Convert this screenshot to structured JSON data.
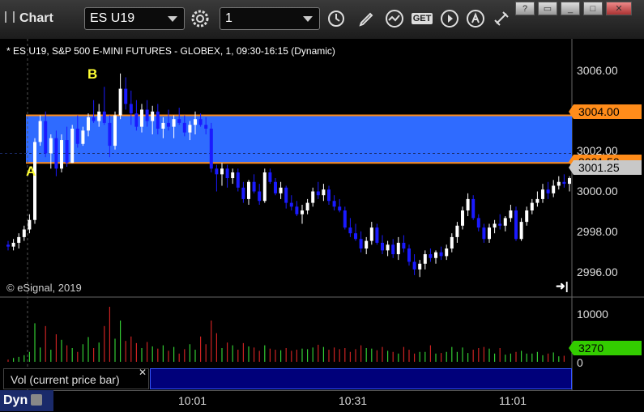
{
  "toolbar": {
    "title": "Chart",
    "symbol": "ES U19",
    "interval": "1",
    "get_label": "GET"
  },
  "chart_header": "* ES U19, S&P 500 E-MINI FUTURES - GLOBEX, 1, 09:30-16:15 (Dynamic)",
  "copyright": "© eSignal, 2019",
  "annotations": {
    "a": "A",
    "b": "B"
  },
  "price_axis": {
    "ticks": [
      "3006.00",
      "3004.00",
      "3002.00",
      "3000.00",
      "2998.00",
      "2996.00"
    ],
    "tags": [
      {
        "label": "3004.00",
        "bg": "#ff8c1a",
        "fg": "#000"
      },
      {
        "label": "3001.50",
        "bg": "#ff8c1a",
        "fg": "#000"
      },
      {
        "label": "3001.25",
        "bg": "#c8c8c8",
        "fg": "#000"
      }
    ]
  },
  "volume_axis": {
    "ticks": [
      "10000",
      "0"
    ],
    "tag": {
      "label": "3270",
      "bg": "#33cc00",
      "fg": "#000"
    }
  },
  "volume_label": "Vol (current price bar)",
  "time_axis": {
    "ticks": [
      "10:01",
      "10:31",
      "11:01"
    ]
  },
  "status": {
    "dyn_label": "Dyn"
  },
  "colors": {
    "up": "#ffffff",
    "down": "#1a1aff",
    "zone": "#2f6bff",
    "zone_line": "#ff8c1a",
    "vol_up": "#33cc33",
    "vol_down": "#cc2222"
  },
  "chart_data": {
    "type": "candlestick",
    "ylim": [
      2995.0,
      3007.0
    ],
    "zone": [
      3001.5,
      3004.0
    ],
    "candles": [
      [
        2997.2,
        2997.4,
        2996.9,
        2997.1
      ],
      [
        2997.1,
        2997.5,
        2996.9,
        2997.3
      ],
      [
        2997.3,
        2997.8,
        2997.0,
        2997.6
      ],
      [
        2997.6,
        2998.2,
        2997.4,
        2998.0
      ],
      [
        2998.0,
        2998.8,
        2997.8,
        2998.5
      ],
      [
        2998.5,
        3002.8,
        2998.3,
        3002.6
      ],
      [
        3002.6,
        3004.0,
        3002.4,
        3003.7
      ],
      [
        3003.7,
        3004.2,
        3001.8,
        3002.0
      ],
      [
        3002.0,
        3003.0,
        3001.2,
        3002.8
      ],
      [
        3002.8,
        3003.2,
        3000.8,
        3001.2
      ],
      [
        3001.2,
        3003.0,
        3001.0,
        3002.7
      ],
      [
        3002.7,
        3003.4,
        3001.3,
        3001.5
      ],
      [
        3001.5,
        3003.5,
        3001.5,
        3003.3
      ],
      [
        3003.3,
        3004.0,
        3002.3,
        3002.5
      ],
      [
        3002.5,
        3003.4,
        3002.4,
        3003.2
      ],
      [
        3003.2,
        3004.1,
        3002.9,
        3003.9
      ],
      [
        3003.9,
        3004.8,
        3003.6,
        3003.7
      ],
      [
        3003.7,
        3004.6,
        3003.4,
        3004.2
      ],
      [
        3004.2,
        3005.5,
        3003.5,
        3003.6
      ],
      [
        3003.6,
        3004.0,
        3001.8,
        3002.4
      ],
      [
        3002.4,
        3004.2,
        3002.2,
        3004.0
      ],
      [
        3004.0,
        3006.2,
        3003.8,
        3005.4
      ],
      [
        3005.4,
        3006.0,
        3004.3,
        3004.6
      ],
      [
        3004.6,
        3005.3,
        3003.5,
        3004.1
      ],
      [
        3004.1,
        3004.8,
        3003.2,
        3003.4
      ],
      [
        3003.4,
        3004.6,
        3003.1,
        3004.3
      ],
      [
        3004.3,
        3004.8,
        3003.4,
        3003.7
      ],
      [
        3003.7,
        3004.5,
        3003.0,
        3004.2
      ],
      [
        3004.2,
        3004.6,
        3003.0,
        3003.3
      ],
      [
        3003.3,
        3003.9,
        3002.8,
        3003.6
      ],
      [
        3003.6,
        3004.3,
        3003.2,
        3003.4
      ],
      [
        3003.4,
        3004.0,
        3002.8,
        3003.8
      ],
      [
        3003.8,
        3004.4,
        3003.5,
        3003.6
      ],
      [
        3003.6,
        3004.0,
        3002.9,
        3003.1
      ],
      [
        3003.1,
        3003.7,
        3002.7,
        3003.5
      ],
      [
        3003.5,
        3004.2,
        3003.0,
        3003.8
      ],
      [
        3003.8,
        3004.1,
        3003.4,
        3003.5
      ],
      [
        3003.5,
        3003.9,
        3003.0,
        3003.3
      ],
      [
        3003.3,
        3003.6,
        3001.0,
        3001.2
      ],
      [
        3001.2,
        3001.4,
        3000.0,
        3000.9
      ],
      [
        3000.9,
        3001.5,
        3000.3,
        3001.2
      ],
      [
        3001.2,
        3001.4,
        3000.2,
        3000.7
      ],
      [
        3000.7,
        3001.2,
        3000.4,
        3001.0
      ],
      [
        3001.0,
        3001.2,
        3000.0,
        3000.2
      ],
      [
        3000.2,
        3000.5,
        2999.4,
        2999.6
      ],
      [
        2999.6,
        3000.6,
        2999.3,
        3000.5
      ],
      [
        3000.5,
        3000.9,
        2999.9,
        3000.0
      ],
      [
        3000.0,
        3000.4,
        2999.3,
        2999.5
      ],
      [
        2999.5,
        3001.2,
        2999.4,
        3001.0
      ],
      [
        3001.0,
        3001.2,
        3000.4,
        3000.5
      ],
      [
        3000.5,
        3000.7,
        2999.8,
        2999.9
      ],
      [
        2999.9,
        3000.5,
        2999.6,
        3000.2
      ],
      [
        3000.2,
        3000.3,
        2999.1,
        2999.4
      ],
      [
        2999.4,
        2999.8,
        2999.0,
        2999.2
      ],
      [
        2999.2,
        2999.5,
        2998.7,
        2998.8
      ],
      [
        2998.8,
        2999.3,
        2998.3,
        2999.0
      ],
      [
        2999.0,
        2999.6,
        2998.8,
        2999.4
      ],
      [
        2999.4,
        3000.2,
        2999.2,
        3000.0
      ],
      [
        3000.0,
        3000.5,
        2999.6,
        2999.8
      ],
      [
        2999.8,
        3000.4,
        2999.5,
        3000.1
      ],
      [
        3000.1,
        3000.3,
        2999.3,
        2999.5
      ],
      [
        2999.5,
        2999.8,
        2999.0,
        2999.2
      ],
      [
        2999.2,
        2999.6,
        2998.9,
        2999.0
      ],
      [
        2999.0,
        2999.2,
        2998.0,
        2998.1
      ],
      [
        2998.1,
        2998.6,
        2997.6,
        2997.8
      ],
      [
        2997.8,
        2998.3,
        2997.4,
        2997.5
      ],
      [
        2997.5,
        2997.9,
        2996.8,
        2997.0
      ],
      [
        2997.0,
        2997.6,
        2996.7,
        2997.4
      ],
      [
        2997.4,
        2998.4,
        2997.2,
        2998.1
      ],
      [
        2998.1,
        2998.3,
        2997.2,
        2997.3
      ],
      [
        2997.3,
        2997.7,
        2996.7,
        2996.9
      ],
      [
        2996.9,
        2997.4,
        2996.6,
        2997.2
      ],
      [
        2997.2,
        2997.5,
        2996.5,
        2996.7
      ],
      [
        2996.7,
        2997.6,
        2996.4,
        2997.3
      ],
      [
        2997.3,
        2997.7,
        2996.8,
        2997.0
      ],
      [
        2997.0,
        2997.2,
        2996.1,
        2996.3
      ],
      [
        2996.3,
        2996.7,
        2995.6,
        2995.9
      ],
      [
        2995.9,
        2996.4,
        2995.5,
        2996.2
      ],
      [
        2996.2,
        2996.9,
        2995.9,
        2996.7
      ],
      [
        2996.7,
        2997.0,
        2996.3,
        2996.5
      ],
      [
        2996.5,
        2996.9,
        2996.2,
        2996.8
      ],
      [
        2996.8,
        2997.1,
        2996.4,
        2996.6
      ],
      [
        2996.6,
        2997.2,
        2996.4,
        2997.0
      ],
      [
        2997.0,
        2997.8,
        2996.8,
        2997.6
      ],
      [
        2997.6,
        2998.4,
        2997.3,
        2998.2
      ],
      [
        2998.2,
        2999.2,
        2998.0,
        2999.0
      ],
      [
        2999.0,
        2999.9,
        2998.7,
        2999.6
      ],
      [
        2999.6,
        2999.8,
        2998.5,
        2998.6
      ],
      [
        2998.6,
        2998.8,
        2997.9,
        2998.1
      ],
      [
        2998.1,
        2998.3,
        2997.3,
        2997.5
      ],
      [
        2997.5,
        2998.3,
        2997.3,
        2998.1
      ],
      [
        2998.1,
        2998.5,
        2997.8,
        2998.3
      ],
      [
        2998.3,
        2998.8,
        2998.0,
        2998.2
      ],
      [
        2998.2,
        2998.7,
        2997.9,
        2998.6
      ],
      [
        2998.6,
        2999.3,
        2998.4,
        2999.0
      ],
      [
        2999.0,
        2999.2,
        2997.4,
        2997.5
      ],
      [
        2997.5,
        2998.6,
        2997.4,
        2998.4
      ],
      [
        2998.4,
        2999.2,
        2998.2,
        2999.0
      ],
      [
        2999.0,
        2999.6,
        2998.8,
        2999.4
      ],
      [
        2999.4,
        3000.0,
        2999.2,
        2999.6
      ],
      [
        2999.6,
        3000.4,
        2999.4,
        3000.1
      ],
      [
        3000.1,
        3000.5,
        2999.6,
        2999.9
      ],
      [
        2999.9,
        3000.6,
        2999.7,
        3000.3
      ],
      [
        3000.3,
        3000.8,
        3000.1,
        3000.5
      ],
      [
        3000.5,
        3000.9,
        3000.2,
        3000.4
      ],
      [
        3000.4,
        3000.8,
        3000.0,
        3000.7
      ]
    ],
    "volume": [
      400,
      700,
      900,
      1200,
      1800,
      7000,
      2600,
      6500,
      2200,
      5000,
      4000,
      3000,
      2500,
      1800,
      3200,
      4500,
      2500,
      3500,
      6500,
      10000,
      4200,
      7500,
      3800,
      4600,
      3400,
      2500,
      3600,
      2800,
      2400,
      3000,
      2000,
      2700,
      1500,
      2300,
      3200,
      2200,
      4600,
      3200,
      7500,
      5200,
      2500,
      3500,
      3000,
      2200,
      3400,
      2800,
      2600,
      2000,
      3000,
      2400,
      2200,
      2100,
      2500,
      2000,
      2200,
      2400,
      2300,
      2600,
      3100,
      2700,
      2200,
      2600,
      2300,
      2500,
      1800,
      2300,
      3000,
      2500,
      2400,
      2100,
      2700,
      2000,
      1800,
      1500,
      2700,
      2200,
      1500,
      1800,
      1800,
      3000,
      1500,
      1600,
      1800,
      2700,
      1800,
      2600,
      1600,
      2200,
      2500,
      2700,
      2400,
      1500,
      2500,
      1300,
      1500,
      1800,
      2000,
      1500,
      1500,
      1800,
      1200,
      1500,
      1700,
      1000,
      1100
    ]
  }
}
